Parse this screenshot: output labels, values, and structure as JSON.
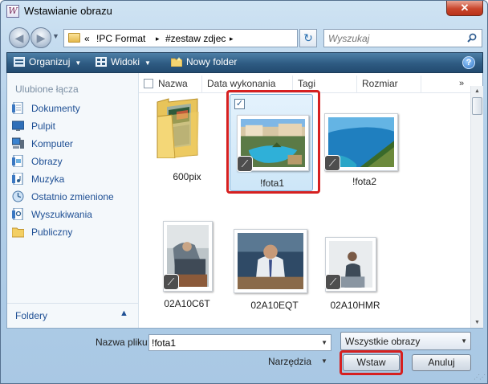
{
  "window": {
    "title": "Wstawianie obrazu",
    "close_label": "✕"
  },
  "address": {
    "breadcrumbs": [
      "«",
      "!PC Format",
      "▸",
      "#zestaw zdjec",
      "▸"
    ],
    "search_placeholder": "Wyszukaj"
  },
  "toolbar": {
    "organize": "Organizuj",
    "views": "Widoki",
    "new_folder": "Nowy folder",
    "help": "?"
  },
  "sidebar": {
    "heading": "Ulubione łącza",
    "items": [
      {
        "label": "Dokumenty",
        "icon": "documents-icon"
      },
      {
        "label": "Pulpit",
        "icon": "desktop-icon"
      },
      {
        "label": "Komputer",
        "icon": "computer-icon"
      },
      {
        "label": "Obrazy",
        "icon": "pictures-icon"
      },
      {
        "label": "Muzyka",
        "icon": "music-icon"
      },
      {
        "label": "Ostatnio zmienione",
        "icon": "recent-icon"
      },
      {
        "label": "Wyszukiwania",
        "icon": "searches-icon"
      },
      {
        "label": "Publiczny",
        "icon": "public-folder-icon"
      }
    ],
    "folders_label": "Foldery"
  },
  "columns": [
    "Nazwa",
    "Data wykonania",
    "Tagi",
    "Rozmiar"
  ],
  "columns_more": "»",
  "files": [
    {
      "name": "600pix",
      "type": "folder"
    },
    {
      "name": "!fota1",
      "type": "image",
      "selected": true
    },
    {
      "name": "!fota2",
      "type": "image"
    },
    {
      "name": "02A10C6T",
      "type": "image"
    },
    {
      "name": "02A10EQT",
      "type": "image"
    },
    {
      "name": "02A10HMR",
      "type": "image"
    }
  ],
  "bottom": {
    "filename_label": "Nazwa pliku:",
    "filename_value": "!fota1",
    "filetype_value": "Wszystkie obrazy",
    "tools_label": "Narzędzia",
    "insert_label": "Wstaw",
    "cancel_label": "Anuluj"
  },
  "colors": {
    "highlight_frame": "#d62020",
    "toolbar": "#2e5b82",
    "link": "#1e4f94"
  }
}
